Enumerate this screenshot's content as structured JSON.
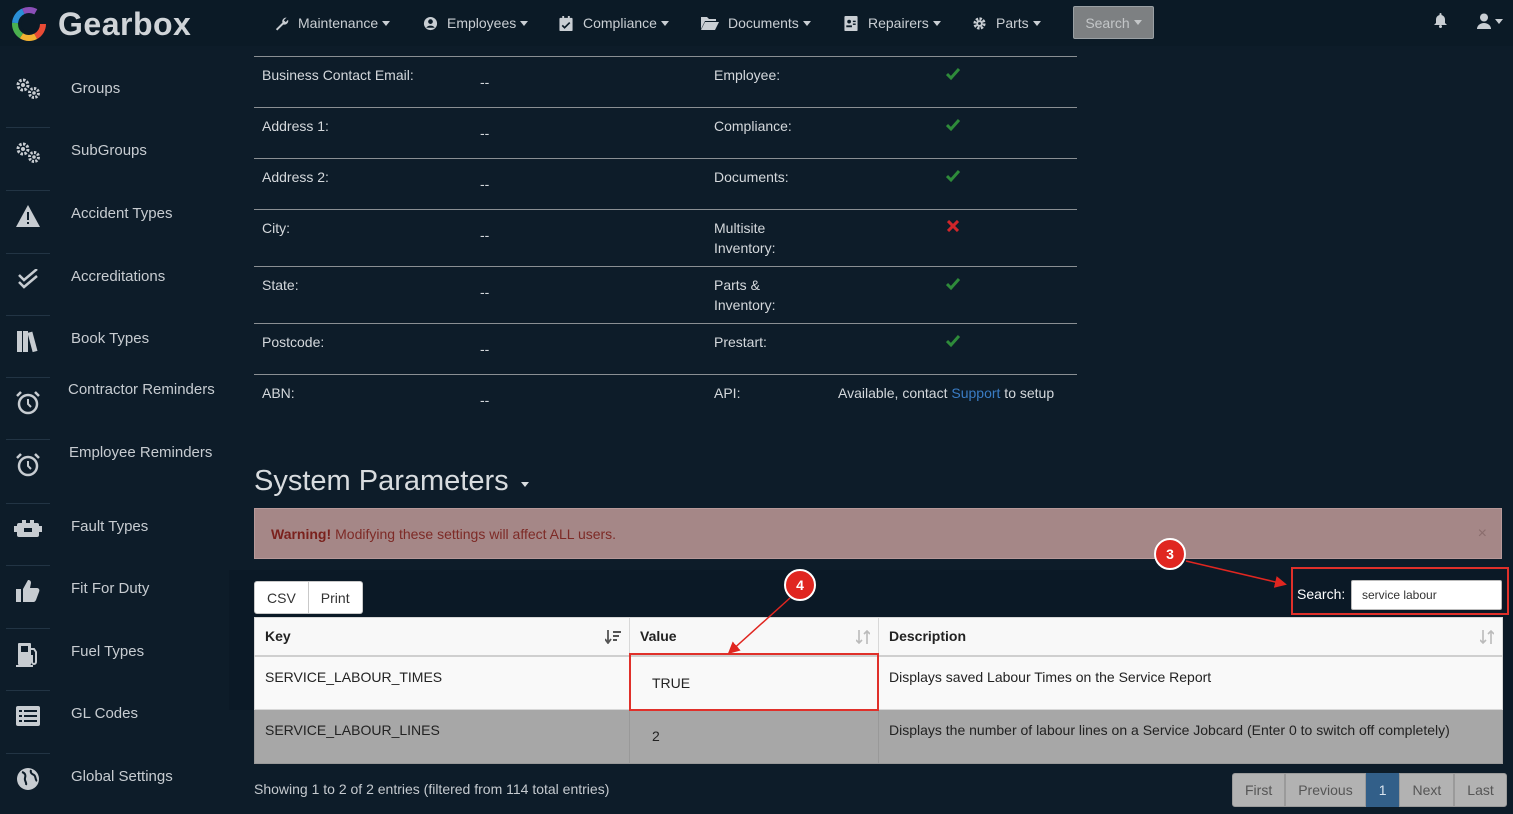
{
  "app": {
    "logo_text": "Gearbox"
  },
  "nav": {
    "items": [
      {
        "label": "Maintenance",
        "icon": "wrench-icon"
      },
      {
        "label": "Employees",
        "icon": "user-circle-icon"
      },
      {
        "label": "Compliance",
        "icon": "calendar-check-icon"
      },
      {
        "label": "Documents",
        "icon": "folder-open-icon"
      },
      {
        "label": "Repairers",
        "icon": "id-card-icon"
      },
      {
        "label": "Parts",
        "icon": "gear-icon"
      }
    ],
    "search_label": "Search"
  },
  "sidebar": {
    "items": [
      {
        "label": "Groups",
        "icon": "gears-icon"
      },
      {
        "label": "SubGroups",
        "icon": "gears-icon"
      },
      {
        "label": "Accident Types",
        "icon": "warning-triangle-icon"
      },
      {
        "label": "Accreditations",
        "icon": "check-double-icon"
      },
      {
        "label": "Book Types",
        "icon": "books-icon"
      },
      {
        "label": "Contractor Reminders",
        "icon": "alarm-clock-icon"
      },
      {
        "label": "Employee Reminders",
        "icon": "alarm-clock-icon"
      },
      {
        "label": "Fault Types",
        "icon": "car-battery-icon"
      },
      {
        "label": "Fit For Duty",
        "icon": "thumbs-up-icon"
      },
      {
        "label": "Fuel Types",
        "icon": "gas-pump-icon"
      },
      {
        "label": "GL Codes",
        "icon": "list-icon"
      },
      {
        "label": "Global Settings",
        "icon": "globe-icon"
      }
    ]
  },
  "info": {
    "rows": [
      {
        "left_label": "Business Contact Email:",
        "left_value": "--",
        "right_label": "Employee:",
        "right_value": "check"
      },
      {
        "left_label": "Address 1:",
        "left_value": "--",
        "right_label": "Compliance:",
        "right_value": "check"
      },
      {
        "left_label": "Address 2:",
        "left_value": "--",
        "right_label": "Documents:",
        "right_value": "check"
      },
      {
        "left_label": "City:",
        "left_value": "--",
        "right_label": "Multisite Inventory:",
        "right_value": "cross"
      },
      {
        "left_label": "State:",
        "left_value": "--",
        "right_label": "Parts & Inventory:",
        "right_value": "check"
      },
      {
        "left_label": "Postcode:",
        "left_value": "--",
        "right_label": "Prestart:",
        "right_value": "check"
      },
      {
        "left_label": "ABN:",
        "left_value": "--",
        "right_label": "API:",
        "right_value": "text"
      }
    ],
    "api_text_before": "Available, contact ",
    "api_link": "Support",
    "api_text_after": " to setup"
  },
  "system_params": {
    "title": "System Parameters",
    "warning_strong": "Warning!",
    "warning_text": "Modifying these settings will affect ALL users.",
    "warning_close": "×",
    "buttons": {
      "csv": "CSV",
      "print": "Print"
    },
    "search_label": "Search:",
    "search_value": "service labour",
    "columns": [
      "Key",
      "Value",
      "Description"
    ],
    "rows": [
      {
        "key": "SERVICE_LABOUR_TIMES",
        "value": "TRUE",
        "description": "Displays saved Labour Times on the Service Report"
      },
      {
        "key": "SERVICE_LABOUR_LINES",
        "value": "2",
        "description": "Displays the number of labour lines on a Service Jobcard (Enter 0 to switch off completely)"
      }
    ],
    "showing": "Showing 1 to 2 of 2 entries (filtered from 114 total entries)",
    "pager": {
      "first": "First",
      "previous": "Previous",
      "current": "1",
      "next": "Next",
      "last": "Last"
    }
  },
  "callouts": {
    "search": "3",
    "value": "4"
  },
  "colors": {
    "background": "#0d1c29",
    "check": "#2e8b3a",
    "cross": "#d0262a",
    "callout": "#e02620",
    "pager_active": "#325f89"
  }
}
